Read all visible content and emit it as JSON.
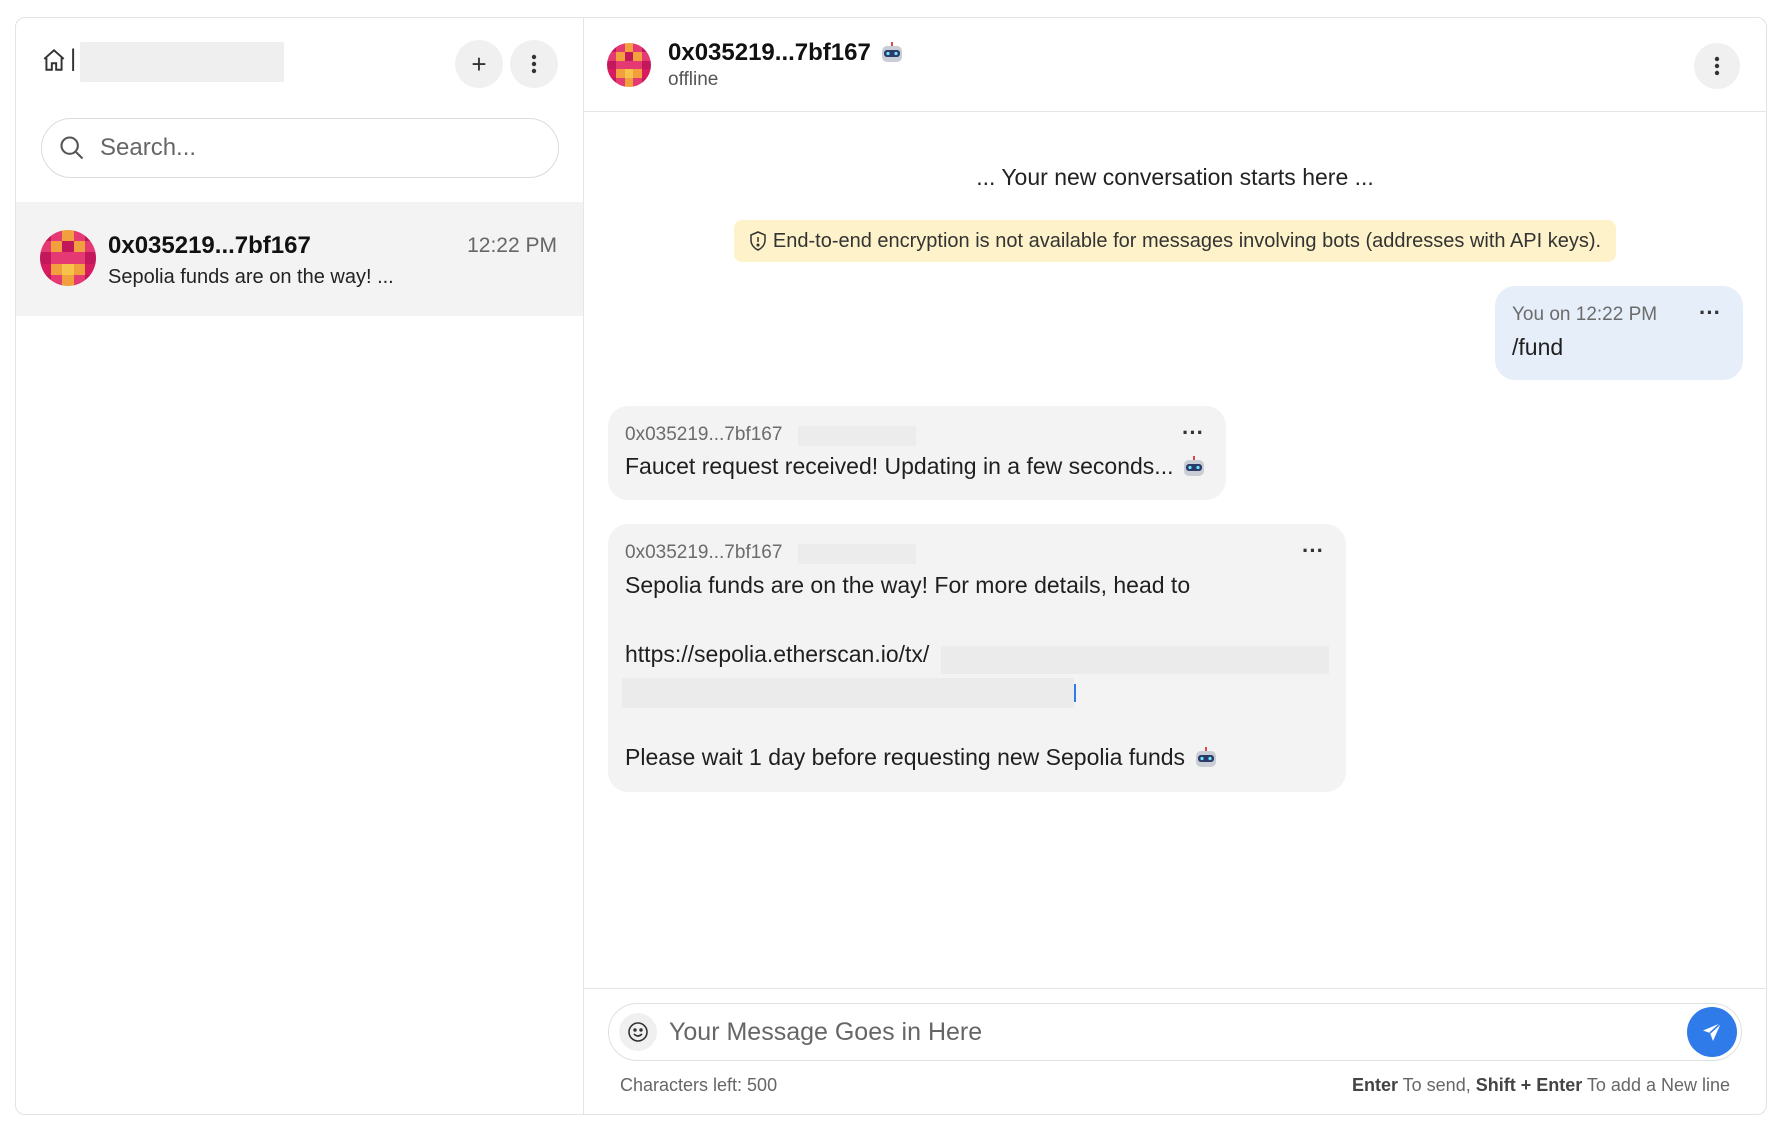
{
  "sidebar": {
    "search_placeholder": "Search...",
    "add_button": "+",
    "conversation": {
      "name": "0x035219...7bf167",
      "time": "12:22 PM",
      "preview": "Sepolia funds are on the way! ..."
    }
  },
  "chat": {
    "contact_name": "0x035219...7bf167",
    "status": "offline",
    "conversation_start": "... Your new conversation starts here ...",
    "encryption_notice": "End-to-end encryption is not available for messages involving bots (addresses with API keys).",
    "messages": [
      {
        "meta": "You on 12:22 PM",
        "text": "/fund"
      },
      {
        "meta": "0x035219...7bf167",
        "text": "Faucet request received! Updating in a few seconds..."
      },
      {
        "meta": "0x035219...7bf167",
        "line1": "Sepolia funds are on the way! For more details, head to",
        "line2": "https://sepolia.etherscan.io/tx/",
        "line3": "Please wait 1 day before requesting new Sepolia funds"
      }
    ],
    "more_label": "···"
  },
  "composer": {
    "placeholder": "Your Message Goes in Here",
    "chars_left": "Characters left: 500",
    "hint_enter": "Enter",
    "hint_send": " To send, ",
    "hint_shift": "Shift + Enter",
    "hint_newline": " To add a New line"
  },
  "colors": {
    "accent": "#2f7bea",
    "banner": "#fdf2c9",
    "outgoing_bubble": "#e6eef9",
    "incoming_bubble": "#f3f3f3"
  }
}
